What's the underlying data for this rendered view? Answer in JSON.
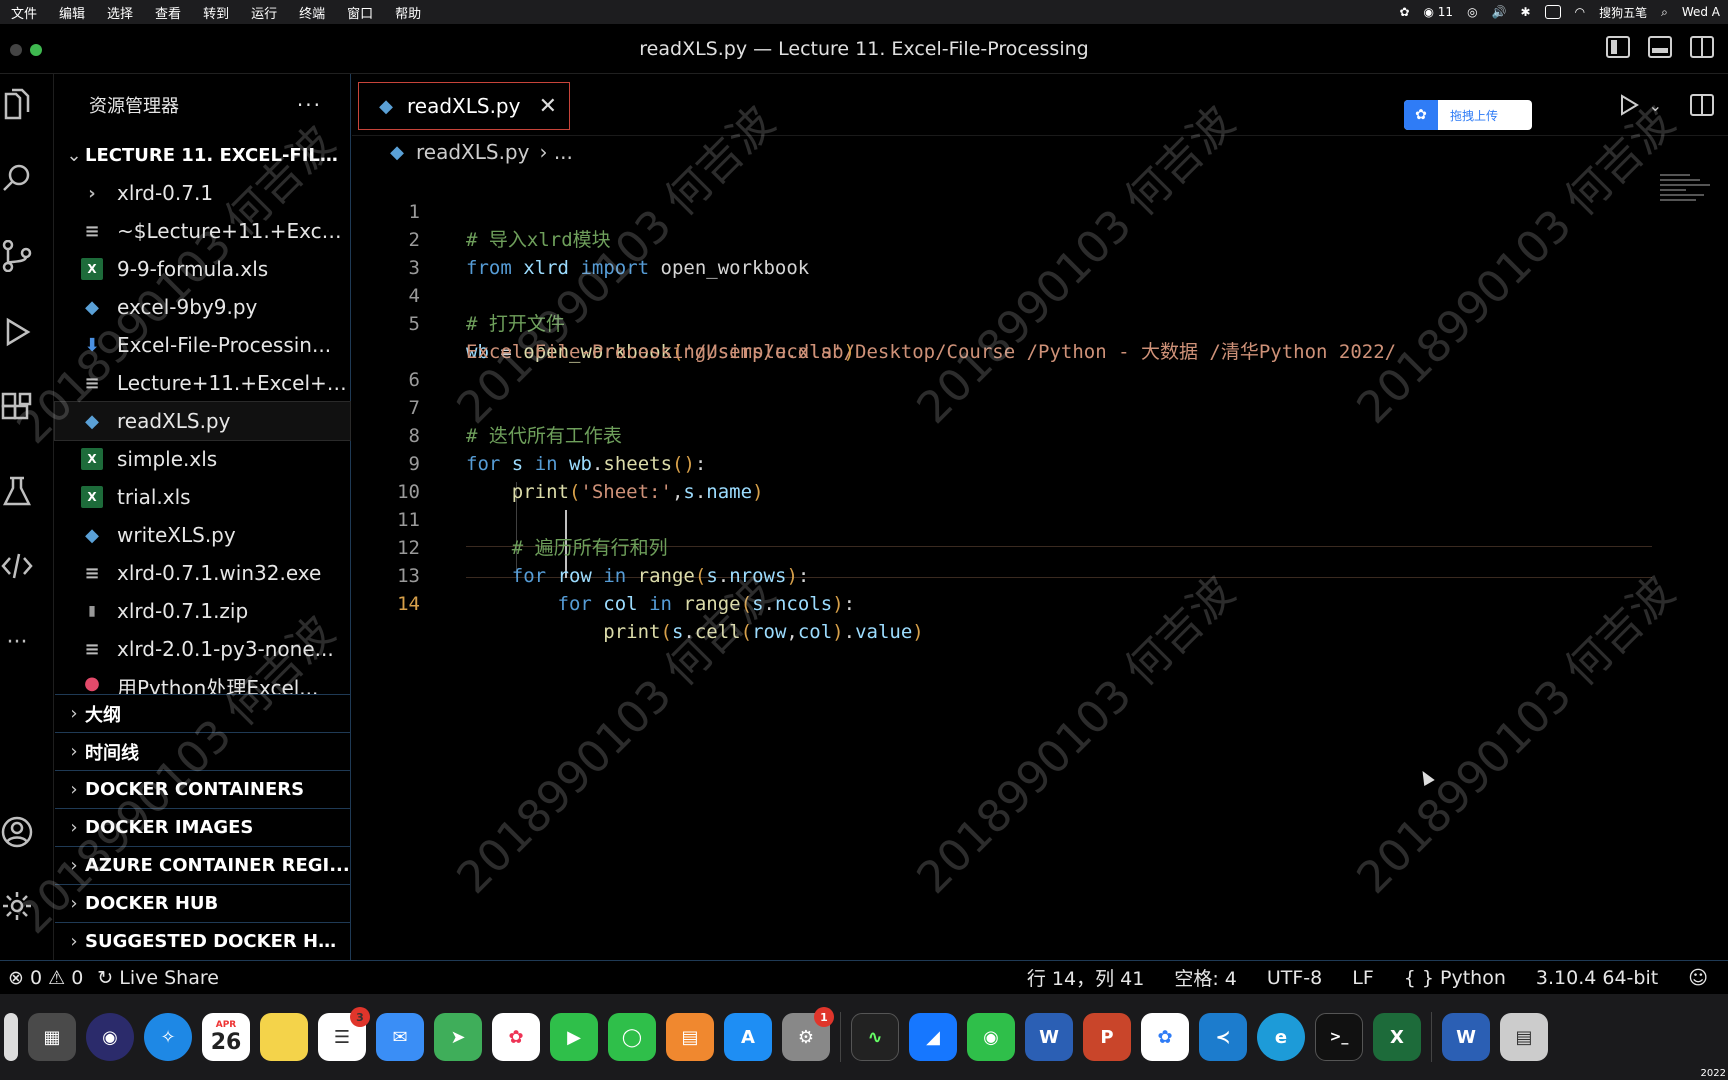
{
  "menubar": {
    "items": [
      "文件",
      "编辑",
      "选择",
      "查看",
      "转到",
      "运行",
      "终端",
      "窗口",
      "帮助"
    ],
    "tray": {
      "wechat_count": "11",
      "input_method": "搜狗五笔",
      "clock": "Wed A"
    }
  },
  "window": {
    "title": "readXLS.py — Lecture 11. Excel-File-Processing"
  },
  "sidebar": {
    "title": "资源管理器",
    "more": "···",
    "folder": "LECTURE 11. EXCEL-FILE...",
    "files": [
      {
        "name": "xlrd-0.7.1",
        "type": "folder"
      },
      {
        "name": "~$Lecture+11.+Excel...",
        "type": "txt"
      },
      {
        "name": "9-9-formula.xls",
        "type": "xls"
      },
      {
        "name": "excel-9by9.py",
        "type": "py"
      },
      {
        "name": "Excel-File-Processin...",
        "type": "dl"
      },
      {
        "name": "Lecture+11.+Excel+F...",
        "type": "txt"
      },
      {
        "name": "readXLS.py",
        "type": "py"
      },
      {
        "name": "simple.xls",
        "type": "xls"
      },
      {
        "name": "trial.xls",
        "type": "xls"
      },
      {
        "name": "writeXLS.py",
        "type": "py"
      },
      {
        "name": "xlrd-0.7.1.win32.exe",
        "type": "txt"
      },
      {
        "name": "xlrd-0.7.1.zip",
        "type": "zip"
      },
      {
        "name": "xlrd-2.0.1-py3-none...",
        "type": "txt"
      },
      {
        "name": "用Python处理Excel...",
        "type": "red"
      }
    ],
    "panels": [
      "大纲",
      "时间线",
      "DOCKER CONTAINERS",
      "DOCKER IMAGES",
      "AZURE CONTAINER REGI...",
      "DOCKER HUB",
      "SUGGESTED DOCKER HU..."
    ]
  },
  "editor": {
    "tab_label": "readXLS.py",
    "upload_label": "拖拽上传",
    "breadcrumb_file": "readXLS.py",
    "breadcrumb_rest": "› ...",
    "line_numbers": [
      "1",
      "2",
      "3",
      "4",
      "5",
      "",
      "6",
      "7",
      "8",
      "9",
      "10",
      "11",
      "12",
      "13",
      "14"
    ]
  },
  "watermark": "2018990103 何吉波",
  "statusbar": {
    "errors": "0",
    "warnings": "0",
    "live_share": "Live Share",
    "position": "行 14，列 41",
    "spaces": "空格: 4",
    "encoding": "UTF-8",
    "eol": "LF",
    "language": "Python",
    "interpreter": "3.10.4 64-bit"
  },
  "dock": {
    "calendar_month": "APR",
    "calendar_day": "26",
    "reminders_badge": "3",
    "settings_badge": "1",
    "date_tiny": "2022"
  }
}
